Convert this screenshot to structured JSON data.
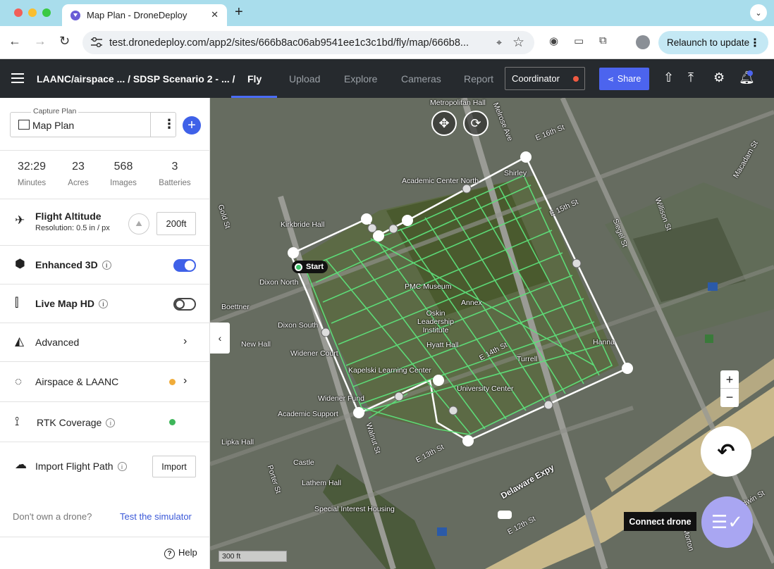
{
  "browser": {
    "tab_title": "Map Plan - DroneDeploy",
    "url": "test.dronedeploy.com/app2/sites/666b8ac06ab9541ee1c3c1bd/fly/map/666b8...",
    "relaunch_label": "Relaunch to update",
    "colors": {
      "tabbar": "#a9ddec",
      "close": "#f25f58",
      "min": "#f9be2e",
      "max": "#3ac943"
    }
  },
  "header": {
    "breadcrumb": "LAANC/airspace ... / SDSP Scenario 2 - ... /",
    "tabs": [
      {
        "label": "Fly",
        "active": true
      },
      {
        "label": "Upload"
      },
      {
        "label": "Explore"
      },
      {
        "label": "Cameras"
      },
      {
        "label": "Report"
      }
    ],
    "coordinator_label": "Coordinator",
    "share_label": "Share"
  },
  "panel": {
    "capture_plan_label": "Capture Plan",
    "capture_plan_value": "Map Plan",
    "stats": [
      {
        "value": "32:29",
        "label": "Minutes"
      },
      {
        "value": "23",
        "label": "Acres"
      },
      {
        "value": "568",
        "label": "Images"
      },
      {
        "value": "3",
        "label": "Batteries"
      }
    ],
    "flight_altitude_label": "Flight Altitude",
    "resolution_text": "Resolution: 0.5 in / px",
    "altitude_value": "200ft",
    "enhanced_3d_label": "Enhanced 3D",
    "enhanced_3d_on": true,
    "live_map_label": "Live Map HD",
    "live_map_on": false,
    "advanced_label": "Advanced",
    "airspace_label": "Airspace & LAANC",
    "airspace_status_color": "#f0ac3a",
    "rtk_label": "RTK Coverage",
    "rtk_status_color": "#3eb65a",
    "import_label": "Import Flight Path",
    "import_button": "Import",
    "no_drone_text": "Don't own a drone?",
    "simulator_link": "Test the simulator",
    "help_label": "Help"
  },
  "map": {
    "start_label": "Start",
    "connect_drone_label": "Connect drone",
    "scale_label": "300 ft",
    "labels": [
      "Metropolitan Hall",
      "Melrose Ave",
      "E 16th St",
      "Shirley",
      "Academic Center North",
      "Kirkbride Hall",
      "Dixon North",
      "PMC Museum",
      "Oskin Leadership Institute",
      "Annex",
      "Hyatt Hall",
      "E 14th St",
      "Dixon South",
      "New Hall",
      "Widener Court",
      "Kapelski Learning Center",
      "University Center",
      "Turrell",
      "Hanna",
      "Widener Fund",
      "Academic Support",
      "Lipka Hall",
      "Castle",
      "Lathem Hall",
      "Special Interest Housing",
      "Delaware Expy",
      "E 13th St",
      "E 12th St",
      "Walnut St",
      "Porter St",
      "Gold St",
      "Boettner",
      "Willison St",
      "Macadam St",
      "Siegel St",
      "E 15th St",
      "Baldwin St",
      "Morton"
    ]
  }
}
